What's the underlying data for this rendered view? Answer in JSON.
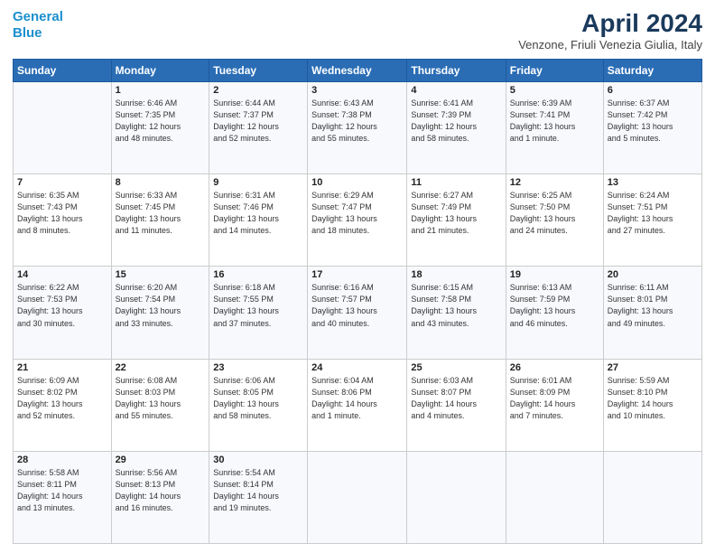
{
  "header": {
    "logo_line1": "General",
    "logo_line2": "Blue",
    "month_title": "April 2024",
    "location": "Venzone, Friuli Venezia Giulia, Italy"
  },
  "weekdays": [
    "Sunday",
    "Monday",
    "Tuesday",
    "Wednesday",
    "Thursday",
    "Friday",
    "Saturday"
  ],
  "weeks": [
    [
      {
        "day": "",
        "info": ""
      },
      {
        "day": "1",
        "info": "Sunrise: 6:46 AM\nSunset: 7:35 PM\nDaylight: 12 hours\nand 48 minutes."
      },
      {
        "day": "2",
        "info": "Sunrise: 6:44 AM\nSunset: 7:37 PM\nDaylight: 12 hours\nand 52 minutes."
      },
      {
        "day": "3",
        "info": "Sunrise: 6:43 AM\nSunset: 7:38 PM\nDaylight: 12 hours\nand 55 minutes."
      },
      {
        "day": "4",
        "info": "Sunrise: 6:41 AM\nSunset: 7:39 PM\nDaylight: 12 hours\nand 58 minutes."
      },
      {
        "day": "5",
        "info": "Sunrise: 6:39 AM\nSunset: 7:41 PM\nDaylight: 13 hours\nand 1 minute."
      },
      {
        "day": "6",
        "info": "Sunrise: 6:37 AM\nSunset: 7:42 PM\nDaylight: 13 hours\nand 5 minutes."
      }
    ],
    [
      {
        "day": "7",
        "info": "Sunrise: 6:35 AM\nSunset: 7:43 PM\nDaylight: 13 hours\nand 8 minutes."
      },
      {
        "day": "8",
        "info": "Sunrise: 6:33 AM\nSunset: 7:45 PM\nDaylight: 13 hours\nand 11 minutes."
      },
      {
        "day": "9",
        "info": "Sunrise: 6:31 AM\nSunset: 7:46 PM\nDaylight: 13 hours\nand 14 minutes."
      },
      {
        "day": "10",
        "info": "Sunrise: 6:29 AM\nSunset: 7:47 PM\nDaylight: 13 hours\nand 18 minutes."
      },
      {
        "day": "11",
        "info": "Sunrise: 6:27 AM\nSunset: 7:49 PM\nDaylight: 13 hours\nand 21 minutes."
      },
      {
        "day": "12",
        "info": "Sunrise: 6:25 AM\nSunset: 7:50 PM\nDaylight: 13 hours\nand 24 minutes."
      },
      {
        "day": "13",
        "info": "Sunrise: 6:24 AM\nSunset: 7:51 PM\nDaylight: 13 hours\nand 27 minutes."
      }
    ],
    [
      {
        "day": "14",
        "info": "Sunrise: 6:22 AM\nSunset: 7:53 PM\nDaylight: 13 hours\nand 30 minutes."
      },
      {
        "day": "15",
        "info": "Sunrise: 6:20 AM\nSunset: 7:54 PM\nDaylight: 13 hours\nand 33 minutes."
      },
      {
        "day": "16",
        "info": "Sunrise: 6:18 AM\nSunset: 7:55 PM\nDaylight: 13 hours\nand 37 minutes."
      },
      {
        "day": "17",
        "info": "Sunrise: 6:16 AM\nSunset: 7:57 PM\nDaylight: 13 hours\nand 40 minutes."
      },
      {
        "day": "18",
        "info": "Sunrise: 6:15 AM\nSunset: 7:58 PM\nDaylight: 13 hours\nand 43 minutes."
      },
      {
        "day": "19",
        "info": "Sunrise: 6:13 AM\nSunset: 7:59 PM\nDaylight: 13 hours\nand 46 minutes."
      },
      {
        "day": "20",
        "info": "Sunrise: 6:11 AM\nSunset: 8:01 PM\nDaylight: 13 hours\nand 49 minutes."
      }
    ],
    [
      {
        "day": "21",
        "info": "Sunrise: 6:09 AM\nSunset: 8:02 PM\nDaylight: 13 hours\nand 52 minutes."
      },
      {
        "day": "22",
        "info": "Sunrise: 6:08 AM\nSunset: 8:03 PM\nDaylight: 13 hours\nand 55 minutes."
      },
      {
        "day": "23",
        "info": "Sunrise: 6:06 AM\nSunset: 8:05 PM\nDaylight: 13 hours\nand 58 minutes."
      },
      {
        "day": "24",
        "info": "Sunrise: 6:04 AM\nSunset: 8:06 PM\nDaylight: 14 hours\nand 1 minute."
      },
      {
        "day": "25",
        "info": "Sunrise: 6:03 AM\nSunset: 8:07 PM\nDaylight: 14 hours\nand 4 minutes."
      },
      {
        "day": "26",
        "info": "Sunrise: 6:01 AM\nSunset: 8:09 PM\nDaylight: 14 hours\nand 7 minutes."
      },
      {
        "day": "27",
        "info": "Sunrise: 5:59 AM\nSunset: 8:10 PM\nDaylight: 14 hours\nand 10 minutes."
      }
    ],
    [
      {
        "day": "28",
        "info": "Sunrise: 5:58 AM\nSunset: 8:11 PM\nDaylight: 14 hours\nand 13 minutes."
      },
      {
        "day": "29",
        "info": "Sunrise: 5:56 AM\nSunset: 8:13 PM\nDaylight: 14 hours\nand 16 minutes."
      },
      {
        "day": "30",
        "info": "Sunrise: 5:54 AM\nSunset: 8:14 PM\nDaylight: 14 hours\nand 19 minutes."
      },
      {
        "day": "",
        "info": ""
      },
      {
        "day": "",
        "info": ""
      },
      {
        "day": "",
        "info": ""
      },
      {
        "day": "",
        "info": ""
      }
    ]
  ]
}
